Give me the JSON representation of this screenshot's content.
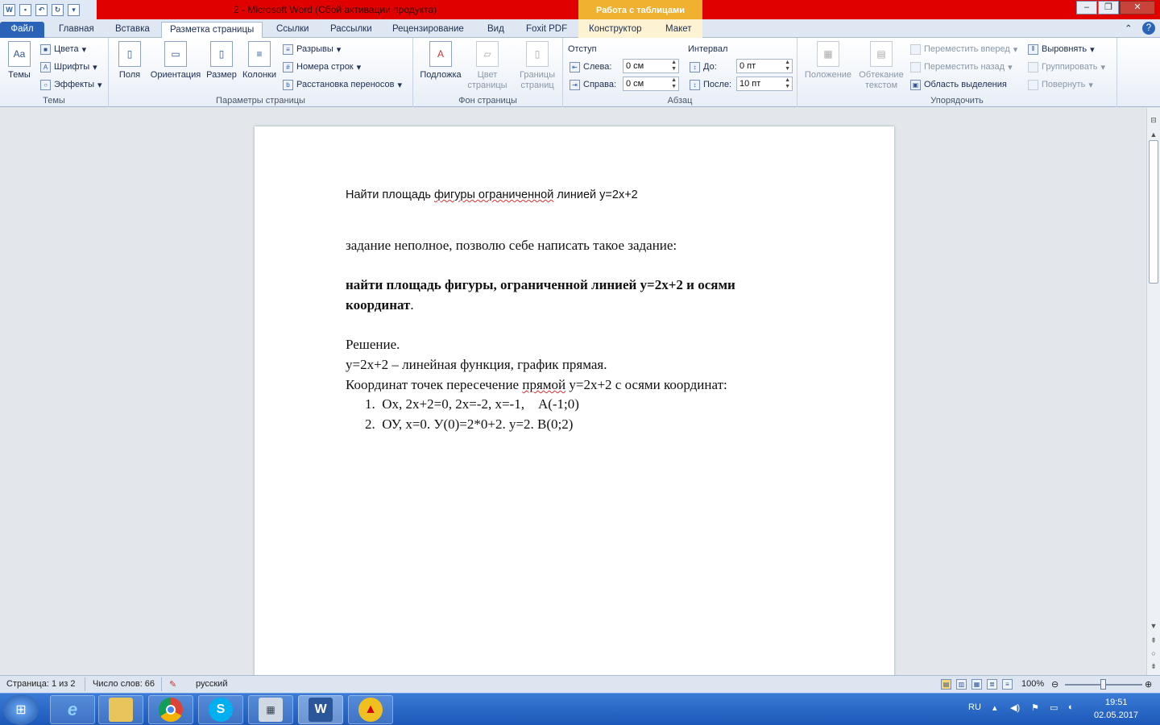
{
  "window": {
    "title": "2 - Microsoft Word (Сбой активации продукта)",
    "contextual_tab_title": "Работа с таблицами"
  },
  "tabs": [
    "Файл",
    "Главная",
    "Вставка",
    "Разметка страницы",
    "Ссылки",
    "Рассылки",
    "Рецензирование",
    "Вид",
    "Foxit PDF",
    "Конструктор",
    "Макет"
  ],
  "ribbon": {
    "themes": {
      "themes_btn": "Темы",
      "colors": "Цвета",
      "fonts": "Шрифты",
      "effects": "Эффекты",
      "label": "Темы"
    },
    "page_setup": {
      "margins": "Поля",
      "orientation": "Ориентация",
      "size": "Размер",
      "columns": "Колонки",
      "breaks": "Разрывы",
      "line_numbers": "Номера строк",
      "hyphenation": "Расстановка переносов",
      "label": "Параметры страницы"
    },
    "page_background": {
      "watermark": "Подложка",
      "page_color_1": "Цвет",
      "page_color_2": "страницы",
      "borders_1": "Границы",
      "borders_2": "страниц",
      "label": "Фон страницы"
    },
    "paragraph": {
      "indent_title": "Отступ",
      "left_label": "Слева:",
      "left_value": "0 см",
      "right_label": "Справа:",
      "right_value": "0 см",
      "spacing_title": "Интервал",
      "before_label": "До:",
      "before_value": "0 пт",
      "after_label": "После:",
      "after_value": "10 пт",
      "label": "Абзац"
    },
    "arrange": {
      "position": "Положение",
      "wrap_1": "Обтекание",
      "wrap_2": "текстом",
      "bring_forward": "Переместить вперед",
      "send_backward": "Переместить назад",
      "selection_pane": "Область выделения",
      "align": "Выровнять",
      "group": "Группировать",
      "rotate": "Повернуть",
      "label": "Упорядочить"
    }
  },
  "document": {
    "line1_a": "Найти площадь ",
    "line1_b": "фигуры ограниченной",
    "line1_c": " линией у=2х+2",
    "line2": "задание неполное, позволю себе написать такое задание:",
    "line3": "найти площадь фигуры, ограниченной линией у=2х+2 и осями",
    "line4_bold": "координат",
    "line4_dot": ".",
    "line5": "Решение.",
    "line6": "у=2х+2 – линейная функция, график прямая.",
    "line7_a": "Координат точек пересечение ",
    "line7_b": "прямой",
    "line7_c": " у=2х+2 с осями координат:",
    "item1_num": "1.",
    "item1": "Ох, 2х+2=0, 2х=-2, х=-1,    А(-1;0)",
    "item2_num": "2.",
    "item2": "ОУ, х=0. У(0)=2*0+2. у=2. В(0;2)"
  },
  "status": {
    "page": "Страница: 1 из 2",
    "words": "Число слов: 66",
    "language": "русский",
    "zoom": "100%"
  },
  "tray": {
    "lang": "RU",
    "time": "19:51",
    "date": "02.05.2017"
  }
}
